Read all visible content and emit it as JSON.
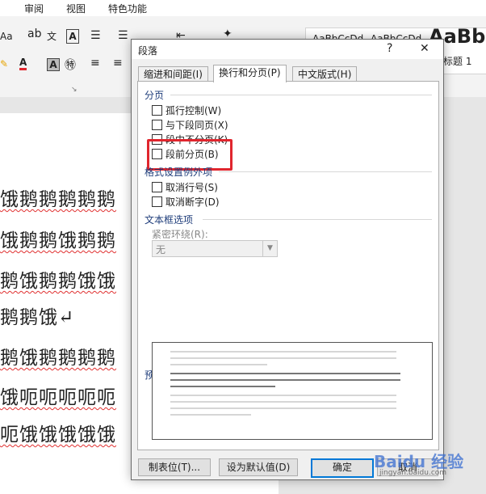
{
  "ribbon": {
    "tabs": [
      "审阅",
      "视图",
      "特色功能"
    ],
    "font_size_label": "Aa",
    "style_samples": [
      "AaBbCcDd",
      "AaBbCcDd",
      "AaBb"
    ],
    "style_caption": "标题 1"
  },
  "document": {
    "lines": [
      "饿鹅鹅鹅鹅鹅",
      "饿鹅鹅饿鹅鹅",
      "鹅饿鹅鹅饿饿",
      "鹅鹅饿↵",
      "鹅饿鹅鹅鹅鹅",
      "饿呃呃呃呃呃",
      "呃饿饿饿饿饿"
    ]
  },
  "dialog": {
    "title": "段落",
    "help": "?",
    "close": "✕",
    "tabs": [
      "缩进和间距(I)",
      "换行和分页(P)",
      "中文版式(H)"
    ],
    "pagination": {
      "header": "分页",
      "options": [
        "孤行控制(W)",
        "与下段同页(X)",
        "段中不分页(K)",
        "段前分页(B)"
      ]
    },
    "exceptions": {
      "header": "格式设置例外项",
      "options": [
        "取消行号(S)",
        "取消断字(D)"
      ]
    },
    "textbox": {
      "header": "文本框选项",
      "wrap_label": "紧密环绕(R):",
      "wrap_value": "无"
    },
    "preview": {
      "header": "预览"
    },
    "buttons": {
      "tabs": "制表位(T)...",
      "default": "设为默认值(D)",
      "ok": "确定",
      "cancel": "取消"
    }
  },
  "watermark": {
    "brand": "Baidu 经验",
    "url": "jingyan.baidu.com"
  },
  "colors": {
    "highlight": "#e0262e",
    "accent": "#0078d7",
    "section_header": "#1e3c7a"
  }
}
